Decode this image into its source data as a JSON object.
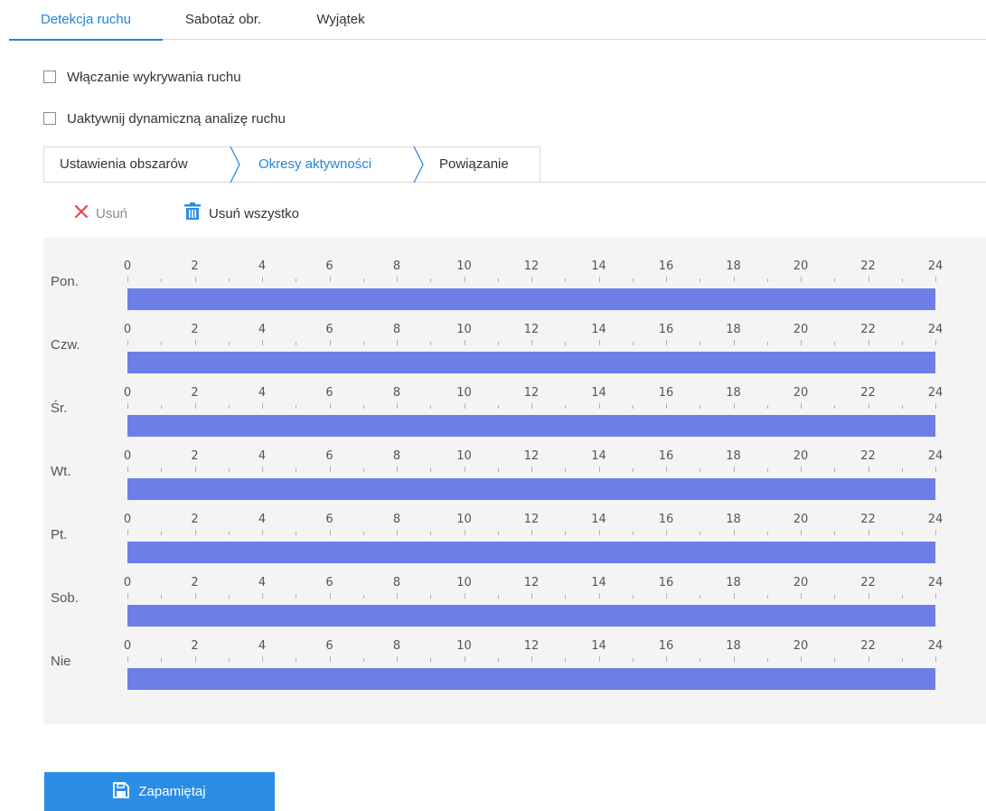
{
  "top_tabs": [
    {
      "label": "Detekcja ruchu",
      "active": true
    },
    {
      "label": "Sabotaż obr.",
      "active": false
    },
    {
      "label": "Wyjątek",
      "active": false
    }
  ],
  "checkboxes": [
    {
      "label": "Włączanie wykrywania ruchu",
      "checked": false
    },
    {
      "label": "Uaktywnij dynamiczną analizę ruchu",
      "checked": false
    }
  ],
  "step_tabs": [
    {
      "label": "Ustawienia obszarów",
      "active": false
    },
    {
      "label": "Okresy aktywności",
      "active": true
    },
    {
      "label": "Powiązanie",
      "active": false
    }
  ],
  "toolbar": {
    "delete_label": "Usuń",
    "delete_icon": "close-icon",
    "delete_all_label": "Usuń wszystko",
    "delete_all_icon": "trash-icon"
  },
  "schedule": {
    "hour_labels": [
      "0",
      "2",
      "4",
      "6",
      "8",
      "10",
      "12",
      "14",
      "16",
      "18",
      "20",
      "22",
      "24"
    ],
    "days": [
      {
        "label": "Pon.",
        "periods": [
          [
            0,
            24
          ]
        ]
      },
      {
        "label": "Czw.",
        "periods": [
          [
            0,
            24
          ]
        ]
      },
      {
        "label": "Śr.",
        "periods": [
          [
            0,
            24
          ]
        ]
      },
      {
        "label": "Wt.",
        "periods": [
          [
            0,
            24
          ]
        ]
      },
      {
        "label": "Pt.",
        "periods": [
          [
            0,
            24
          ]
        ]
      },
      {
        "label": "Sob.",
        "periods": [
          [
            0,
            24
          ]
        ]
      },
      {
        "label": "Nie",
        "periods": [
          [
            0,
            24
          ]
        ]
      }
    ]
  },
  "save_button": {
    "label": "Zapamiętaj",
    "icon": "save-icon"
  },
  "colors": {
    "accent": "#2483d6",
    "period_fill": "#6d7ee6",
    "save_button": "#2c8de4",
    "delete_icon": "#e64646"
  }
}
